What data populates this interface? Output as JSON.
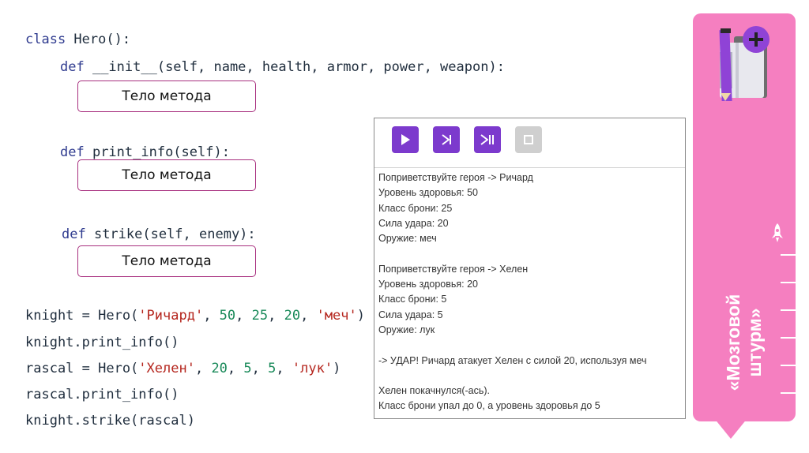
{
  "code": {
    "line1": {
      "kw": "class",
      "rest": " Hero():"
    },
    "line2": {
      "kw": "def",
      "rest": " __init__(self, name, health, armor, power, weapon):"
    },
    "line3": {
      "kw": "def",
      "rest": " print_info(self):"
    },
    "line4": {
      "kw": "def",
      "rest": " strike(self, enemy):"
    },
    "knight_create": {
      "prefix": "knight = Hero(",
      "name": "'Ричард'",
      "sep1": ", ",
      "n1": "50",
      "sep2": ", ",
      "n2": "25",
      "sep3": ", ",
      "n3": "20",
      "sep4": ", ",
      "weapon": "'меч'",
      "suffix": ")"
    },
    "knight_info": "knight.print_info()",
    "rascal_create": {
      "prefix": "rascal = Hero(",
      "name": "'Хелен'",
      "sep1": ", ",
      "n1": "20",
      "sep2": ", ",
      "n2": "5",
      "sep3": ", ",
      "n3": "5",
      "sep4": ", ",
      "weapon": "'лук'",
      "suffix": ")"
    },
    "rascal_info": "rascal.print_info()",
    "knight_strike": "knight.strike(rascal)"
  },
  "method_body_label": "Тело метода",
  "console": {
    "buttons": {
      "run": "play-icon",
      "step": "step-icon",
      "step_over": "step-over-icon",
      "stop": "stop-icon"
    },
    "output": [
      "Поприветствуйте героя -> Ричард",
      "Уровень здоровья: 50",
      "Класс брони: 25",
      "Сила удара: 20",
      "Оружие: меч",
      "",
      "Поприветствуйте героя -> Хелен",
      "Уровень здоровья: 20",
      "Класс брони: 5",
      "Сила удара: 5",
      "Оружие: лук",
      "",
      "-> УДАР! Ричард атакует Хелен с силой 20, используя меч",
      "",
      "Хелен покачнулся(-ась).",
      "Класс брони упал до 0, а уровень здоровья до 5"
    ]
  },
  "sidebar": {
    "title_line1": "«Мозговой",
    "title_line2": "штурм»",
    "icons": [
      "notebook-pencil-plus-icon",
      "rocket-icon"
    ],
    "colors": {
      "sidebar": "#f57fc0",
      "accent": "#7c3acd"
    }
  }
}
